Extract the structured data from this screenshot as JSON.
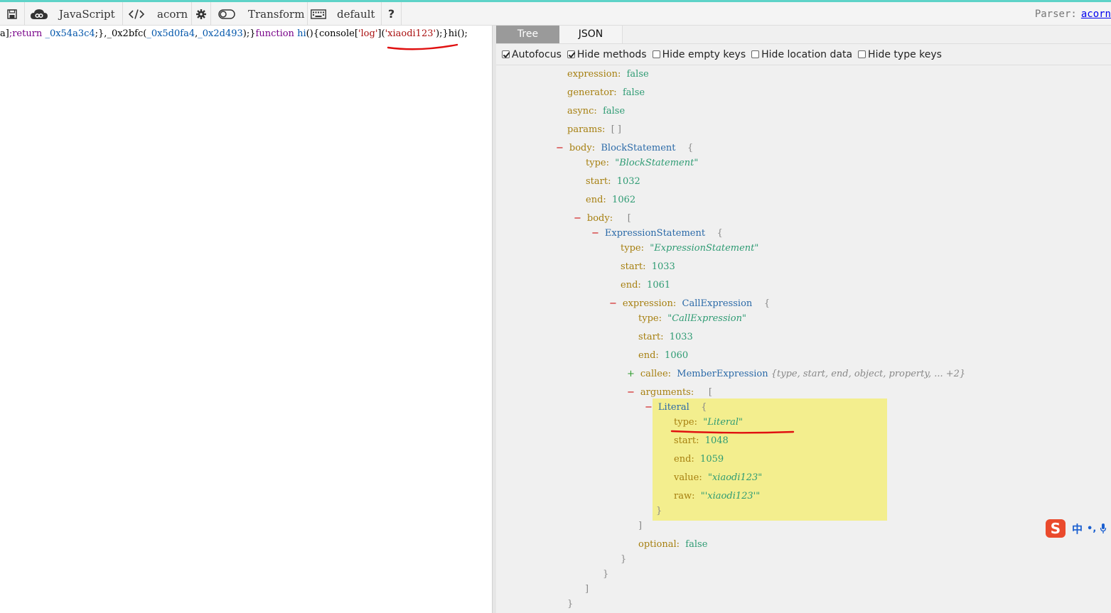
{
  "toolbar": {
    "save_icon": "save-icon",
    "snippet_icon": "cloud-icon",
    "language": "JavaScript",
    "parser_icon": "code-icon",
    "parser_name": "acorn",
    "settings_icon": "gear-icon",
    "transform_icon": "toggle-icon",
    "transform_label": "Transform",
    "keymap_icon": "keyboard-icon",
    "keymap_label": "default",
    "help_label": "?",
    "parser_prefix": "Parser:",
    "parser_link": "acorn"
  },
  "editor": {
    "segments": [
      {
        "text": "a]",
        "kind": "fn"
      },
      {
        "text": ";return ",
        "kind": "kw"
      },
      {
        "text": "_0x54a3c4",
        "kind": "vr"
      },
      {
        "text": ";},",
        "kind": "fn"
      },
      {
        "text": "_0x2bfc(",
        "kind": "fn"
      },
      {
        "text": "_0x5d0fa4",
        "kind": "vr"
      },
      {
        "text": ",",
        "kind": "fn"
      },
      {
        "text": "_0x2d493",
        "kind": "vr"
      },
      {
        "text": ");}",
        "kind": "fn"
      },
      {
        "text": "function ",
        "kind": "kw"
      },
      {
        "text": "hi",
        "kind": "vr"
      },
      {
        "text": "(){console[",
        "kind": "fn"
      },
      {
        "text": "'log'",
        "kind": "st"
      },
      {
        "text": "](",
        "kind": "fn"
      },
      {
        "text": "'xiaodi123'",
        "kind": "st"
      },
      {
        "text": ");}hi();",
        "kind": "fn"
      }
    ]
  },
  "panel": {
    "tabs": [
      {
        "label": "Tree",
        "active": true
      },
      {
        "label": "JSON",
        "active": false
      }
    ],
    "options": [
      {
        "label": "Autofocus",
        "checked": true
      },
      {
        "label": "Hide methods",
        "checked": true
      },
      {
        "label": "Hide empty keys",
        "checked": false
      },
      {
        "label": "Hide location data",
        "checked": false
      },
      {
        "label": "Hide type keys",
        "checked": false
      }
    ]
  },
  "tree": {
    "expression_key": "expression:",
    "expression_val": "false",
    "generator_key": "generator:",
    "generator_val": "false",
    "async_key": "async:",
    "async_val": "false",
    "params_key": "params:",
    "params_val": "[ ]",
    "body_key": "body:",
    "body_type": "BlockStatement",
    "open_brace": "{",
    "block_type_key": "type:",
    "block_type_val": "\"BlockStatement\"",
    "block_start_key": "start:",
    "block_start_val": "1032",
    "block_end_key": "end:",
    "block_end_val": "1062",
    "body_arr_key": "body:",
    "open_bracket": "[",
    "stmt_type": "ExpressionStatement",
    "stmt_type_key": "type:",
    "stmt_type_val": "\"ExpressionStatement\"",
    "stmt_start_key": "start:",
    "stmt_start_val": "1033",
    "stmt_end_key": "end:",
    "stmt_end_val": "1061",
    "expr_key": "expression:",
    "expr_type": "CallExpression",
    "call_type_key": "type:",
    "call_type_val": "\"CallExpression\"",
    "call_start_key": "start:",
    "call_start_val": "1033",
    "call_end_key": "end:",
    "call_end_val": "1060",
    "callee_key": "callee:",
    "callee_type": "MemberExpression",
    "callee_summary": "{type, start, end, object, property, ... +2}",
    "args_key": "arguments:",
    "lit_type": "Literal",
    "lit_type_key": "type:",
    "lit_type_val": "\"Literal\"",
    "lit_start_key": "start:",
    "lit_start_val": "1048",
    "lit_end_key": "end:",
    "lit_end_val": "1059",
    "lit_value_key": "value:",
    "lit_value_val": "\"xiaodi123\"",
    "lit_raw_key": "raw:",
    "lit_raw_val": "\"'xiaodi123'\"",
    "close_brace": "}",
    "close_bracket": "]",
    "optional_key": "optional:",
    "optional_val": "false",
    "minus": "−",
    "plus": "+"
  },
  "ime": {
    "logo": "S",
    "lang": "中",
    "punct": "•,",
    "mic_icon": "microphone-icon"
  },
  "colors": {
    "accent": "#5ed3c8",
    "highlight": "#f3ee8e",
    "annotation": "#e01010"
  }
}
